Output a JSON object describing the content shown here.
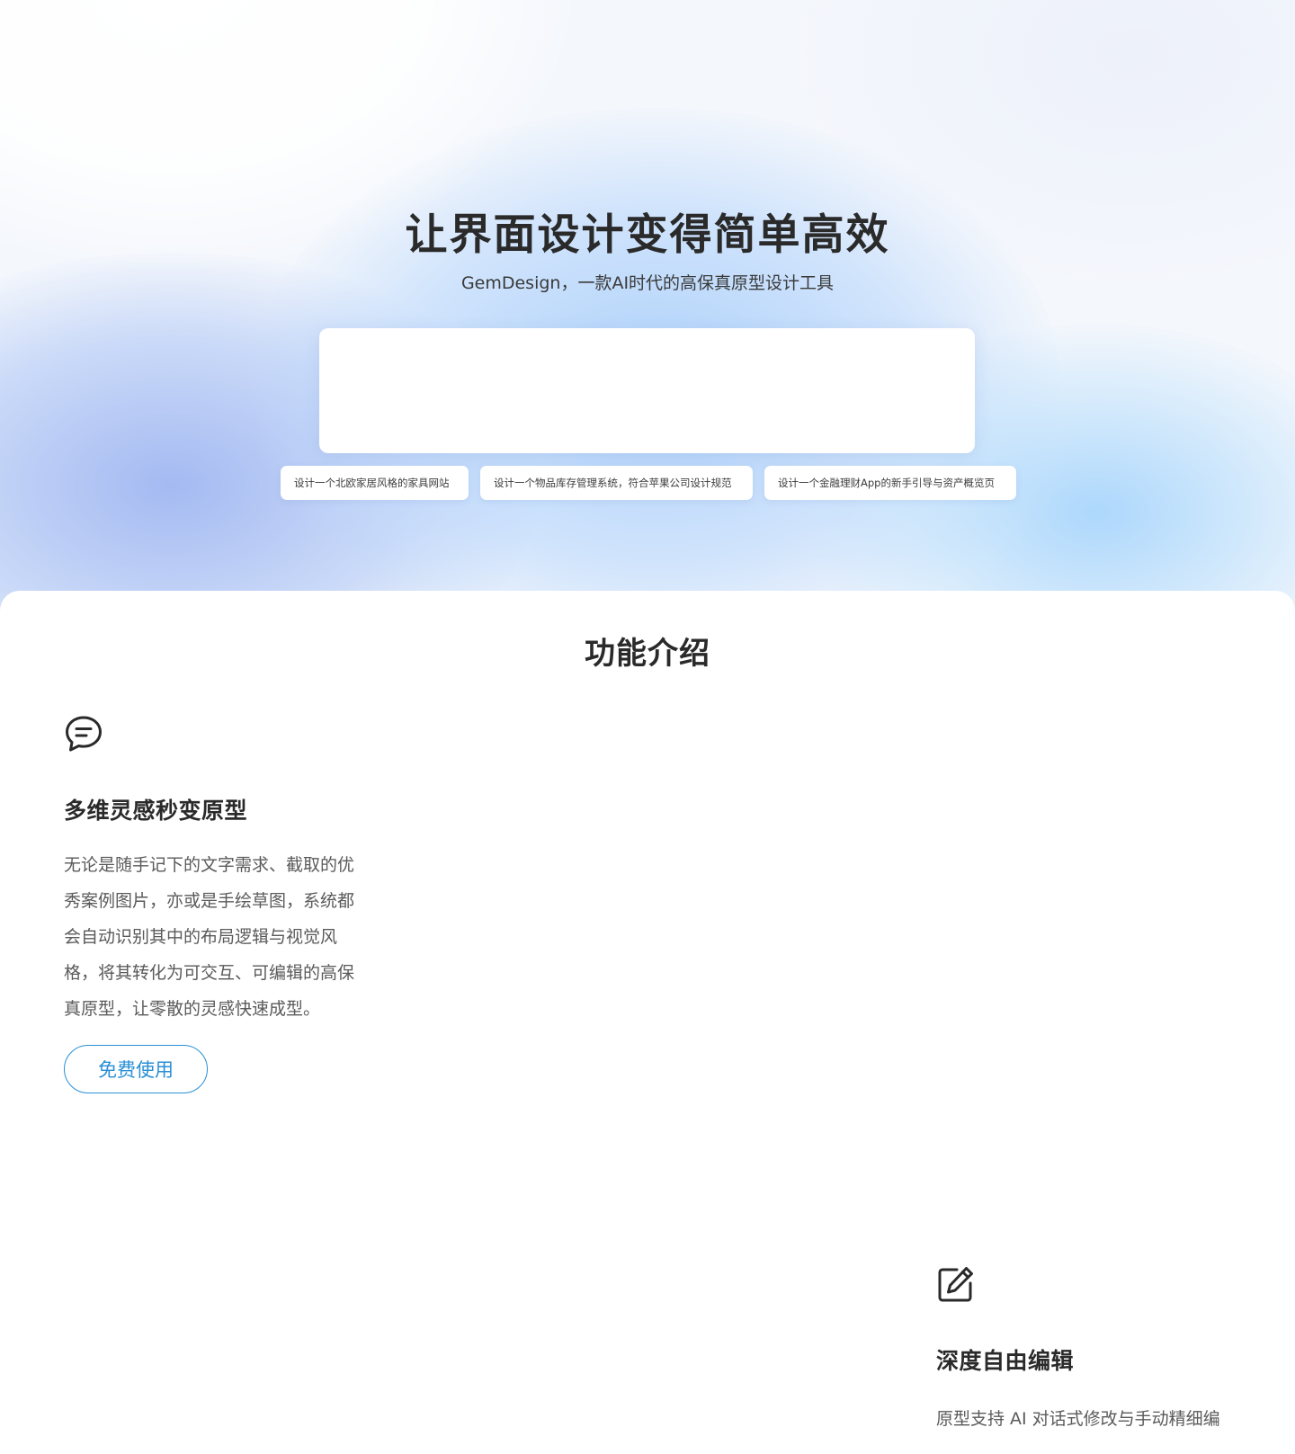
{
  "hero": {
    "title": "让界面设计变得简单高效",
    "subtitle": "GemDesign，一款AI时代的高保真原型设计工具",
    "prompt_value": "",
    "suggestions": [
      "设计一个北欧家居风格的家具网站",
      "设计一个物品库存管理系统，符合苹果公司设计规范",
      "设计一个金融理财App的新手引导与资产概览页"
    ]
  },
  "features": {
    "title": "功能介绍",
    "items": [
      {
        "icon": "chat-bubble-icon",
        "heading": "多维灵感秒变原型",
        "description": "无论是随手记下的文字需求、截取的优秀案例图片，亦或是手绘草图，系统都会自动识别其中的布局逻辑与视觉风格，将其转化为可交互、可编辑的高保真原型，让零散的灵感快速成型。",
        "cta": "免费使用"
      },
      {
        "icon": "edit-icon",
        "heading": "深度自由编辑",
        "description": "原型支持 AI 对话式修改与手动精细编"
      }
    ]
  },
  "colors": {
    "accent": "#2a8fd6",
    "text_primary": "#2a2a2a",
    "text_secondary": "#5a5a5a"
  }
}
